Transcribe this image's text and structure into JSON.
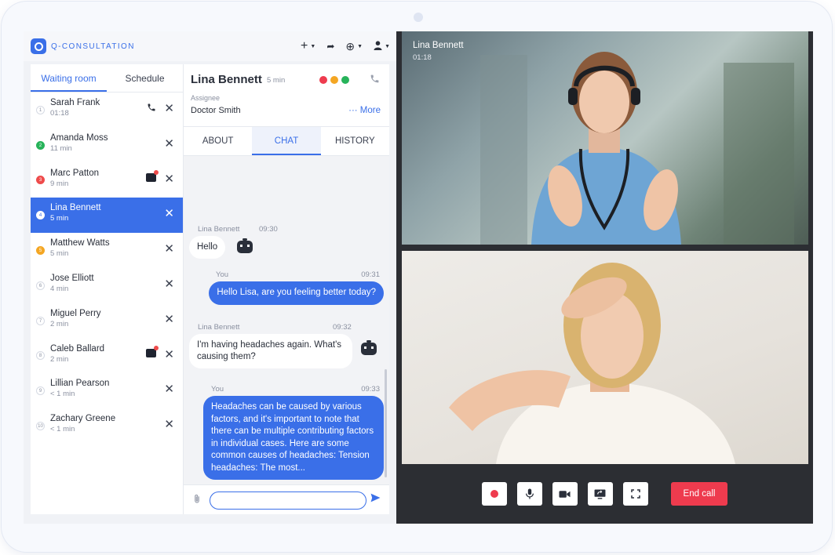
{
  "app": {
    "name": "Q-CONSULTATION",
    "logo_icon": "q-logo-icon"
  },
  "topbar": {
    "add_icon": "+",
    "share_icon": "➦",
    "globe_icon": "⊕",
    "user_icon": "●",
    "caret": "▼"
  },
  "queue": {
    "tabs": [
      "Waiting room",
      "Schedule"
    ],
    "active_tab": 0,
    "items": [
      {
        "number": "1",
        "name": "Sarah Frank",
        "time": "01:18",
        "status": "plain",
        "extra": "phone"
      },
      {
        "number": "2",
        "name": "Amanda Moss",
        "time": "11 min",
        "status": "green",
        "extra": ""
      },
      {
        "number": "3",
        "name": "Marc Patton",
        "time": "9 min",
        "status": "red",
        "extra": "chat"
      },
      {
        "number": "4",
        "name": "Lina Bennett",
        "time": "5 min",
        "status": "active",
        "extra": ""
      },
      {
        "number": "5",
        "name": "Matthew Watts",
        "time": "5 min",
        "status": "orange",
        "extra": ""
      },
      {
        "number": "6",
        "name": "Jose Elliott",
        "time": "4 min",
        "status": "plain",
        "extra": ""
      },
      {
        "number": "7",
        "name": "Miguel Perry",
        "time": "2 min",
        "status": "plain",
        "extra": ""
      },
      {
        "number": "8",
        "name": "Caleb Ballard",
        "time": "2 min",
        "status": "plain",
        "extra": "chat"
      },
      {
        "number": "9",
        "name": "Lillian Pearson",
        "time": "< 1 min",
        "status": "plain",
        "extra": ""
      },
      {
        "number": "10",
        "name": "Zachary Greene",
        "time": "< 1 min",
        "status": "plain",
        "extra": ""
      }
    ]
  },
  "conversation": {
    "patient": "Lina Bennett",
    "duration": "5 min",
    "assignee_label": "Assignee",
    "assignee": "Doctor Smith",
    "more_label": "··· More",
    "status_colors": [
      "#ee3b4e",
      "#f4a623",
      "#27b35a"
    ],
    "tabs": [
      "ABOUT",
      "CHAT",
      "HISTORY"
    ],
    "active_tab": 1,
    "messages": [
      {
        "author": "Lina Bennett",
        "time": "09:30",
        "text": "Hello",
        "direction": "in"
      },
      {
        "author": "You",
        "time": "09:31",
        "text": "Hello Lisa, are you feeling better today?",
        "direction": "out"
      },
      {
        "author": "Lina Bennett",
        "time": "09:32",
        "text": "I'm having headaches again. What's causing them?",
        "direction": "in"
      },
      {
        "author": "You",
        "time": "09:33",
        "text": "Headaches can be caused by various factors, and it's important to note that there can be multiple contributing factors in individual cases. Here are some common causes of headaches: Tension headaches: The most...",
        "direction": "out"
      }
    ],
    "composer_placeholder": ""
  },
  "video": {
    "remote_name": "Lina Bennett",
    "remote_time": "01:18",
    "end_call_label": "End call",
    "controls": [
      "record-icon",
      "microphone-icon",
      "camera-icon",
      "screen-share-icon",
      "fullscreen-icon"
    ]
  }
}
